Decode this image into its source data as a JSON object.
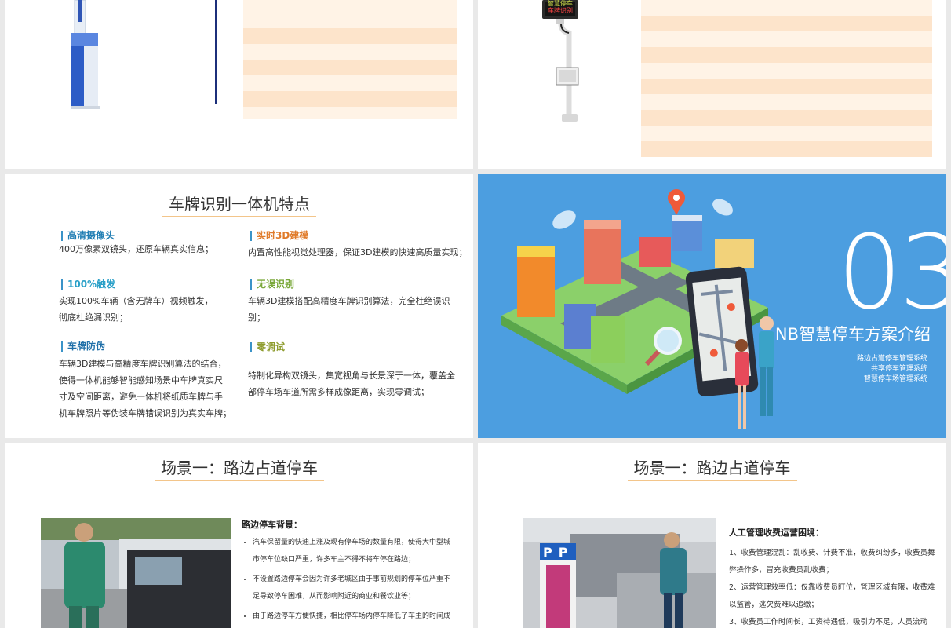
{
  "s1": {},
  "s2": {
    "screen_line1": "智慧停车",
    "screen_line2": "车牌识别"
  },
  "s3": {
    "title": "车牌识别一体机特点",
    "features": [
      {
        "heading": "高清摄像头",
        "color": "#1f7db3",
        "text": "400万像素双镜头，还原车辆真实信息；"
      },
      {
        "heading": "实时3D建模",
        "color": "#e07b2a",
        "text": "内置高性能视觉处理器，保证3D建模的快速高质量实现；"
      },
      {
        "heading": "100%触发",
        "color": "#2aa0c8",
        "text1": "实现100%车辆（含无牌车）视频触发，",
        "text2": "彻底杜绝漏识别；"
      },
      {
        "heading": "无误识别",
        "color": "#7aa83a",
        "text1": "车辆3D建模搭配高精度车牌识别算法，完全杜绝误识",
        "text2": "别；"
      },
      {
        "heading": "车牌防伪",
        "color": "#1f6fa8",
        "lines": [
          "车辆3D建模与高精度车牌识别算法的结合，",
          "使得一体机能够智能感知场景中车牌真实尺",
          "寸及空间距离，避免一体机将纸质车牌与手",
          "机车牌照片等伪装车牌错误识别为真实车牌；"
        ]
      },
      {
        "heading": "零调试",
        "color": "#8c9a2a",
        "text1": "特制化异构双镜头，集宽视角与长景深于一体，覆盖全",
        "text2": "部停车场车道所需多样成像距离，实现零调试；"
      }
    ]
  },
  "s4": {
    "number": "03",
    "title": "NB智慧停车方案介绍",
    "lines": [
      "路边占道停车管理系统",
      "共享停车管理系统",
      "智慧停车场管理系统"
    ]
  },
  "s5": {
    "title": "场景一：路边占道停车",
    "subtitle": "路边停车背景",
    "colon": "：",
    "bullets": [
      [
        "汽车保留量的快速上涨及现有停车场的数量有限，使得大中型城",
        "市停车位缺口严重，许多车主不得不将车停在路边；"
      ],
      [
        "不设置路边停车会因为许多老城区由于事前规划的停车位严重不",
        "足导致停车困难，从而影响附近的商业和餐饮业等；"
      ],
      [
        "由于路边停车方便快捷，相比停车场内停车降低了车主的时间成"
      ]
    ]
  },
  "s6": {
    "title": "场景一：路边占道停车",
    "subtitle": "人工管理收费运营困境",
    "colon": "：",
    "items": [
      [
        "1、收费管理混乱：乱收费、计费不准，收费纠纷多，收费员舞",
        "弊操作多，冒充收费员乱收费；"
      ],
      [
        "2、运营管理效率低：仅靠收费员盯位，管理区域有限，收费难",
        "以监管，逃欠费难以追缴；"
      ],
      [
        "3、收费员工作时间长，工资待遇低，吸引力不足，人员流动快。"
      ]
    ],
    "parking_sign": "P"
  },
  "colors": {
    "accent_orange": "#f3c58a",
    "stripe_dark": "#fde4cb",
    "stripe_light": "#fff3e6",
    "section_blue": "#4c9ee0"
  }
}
